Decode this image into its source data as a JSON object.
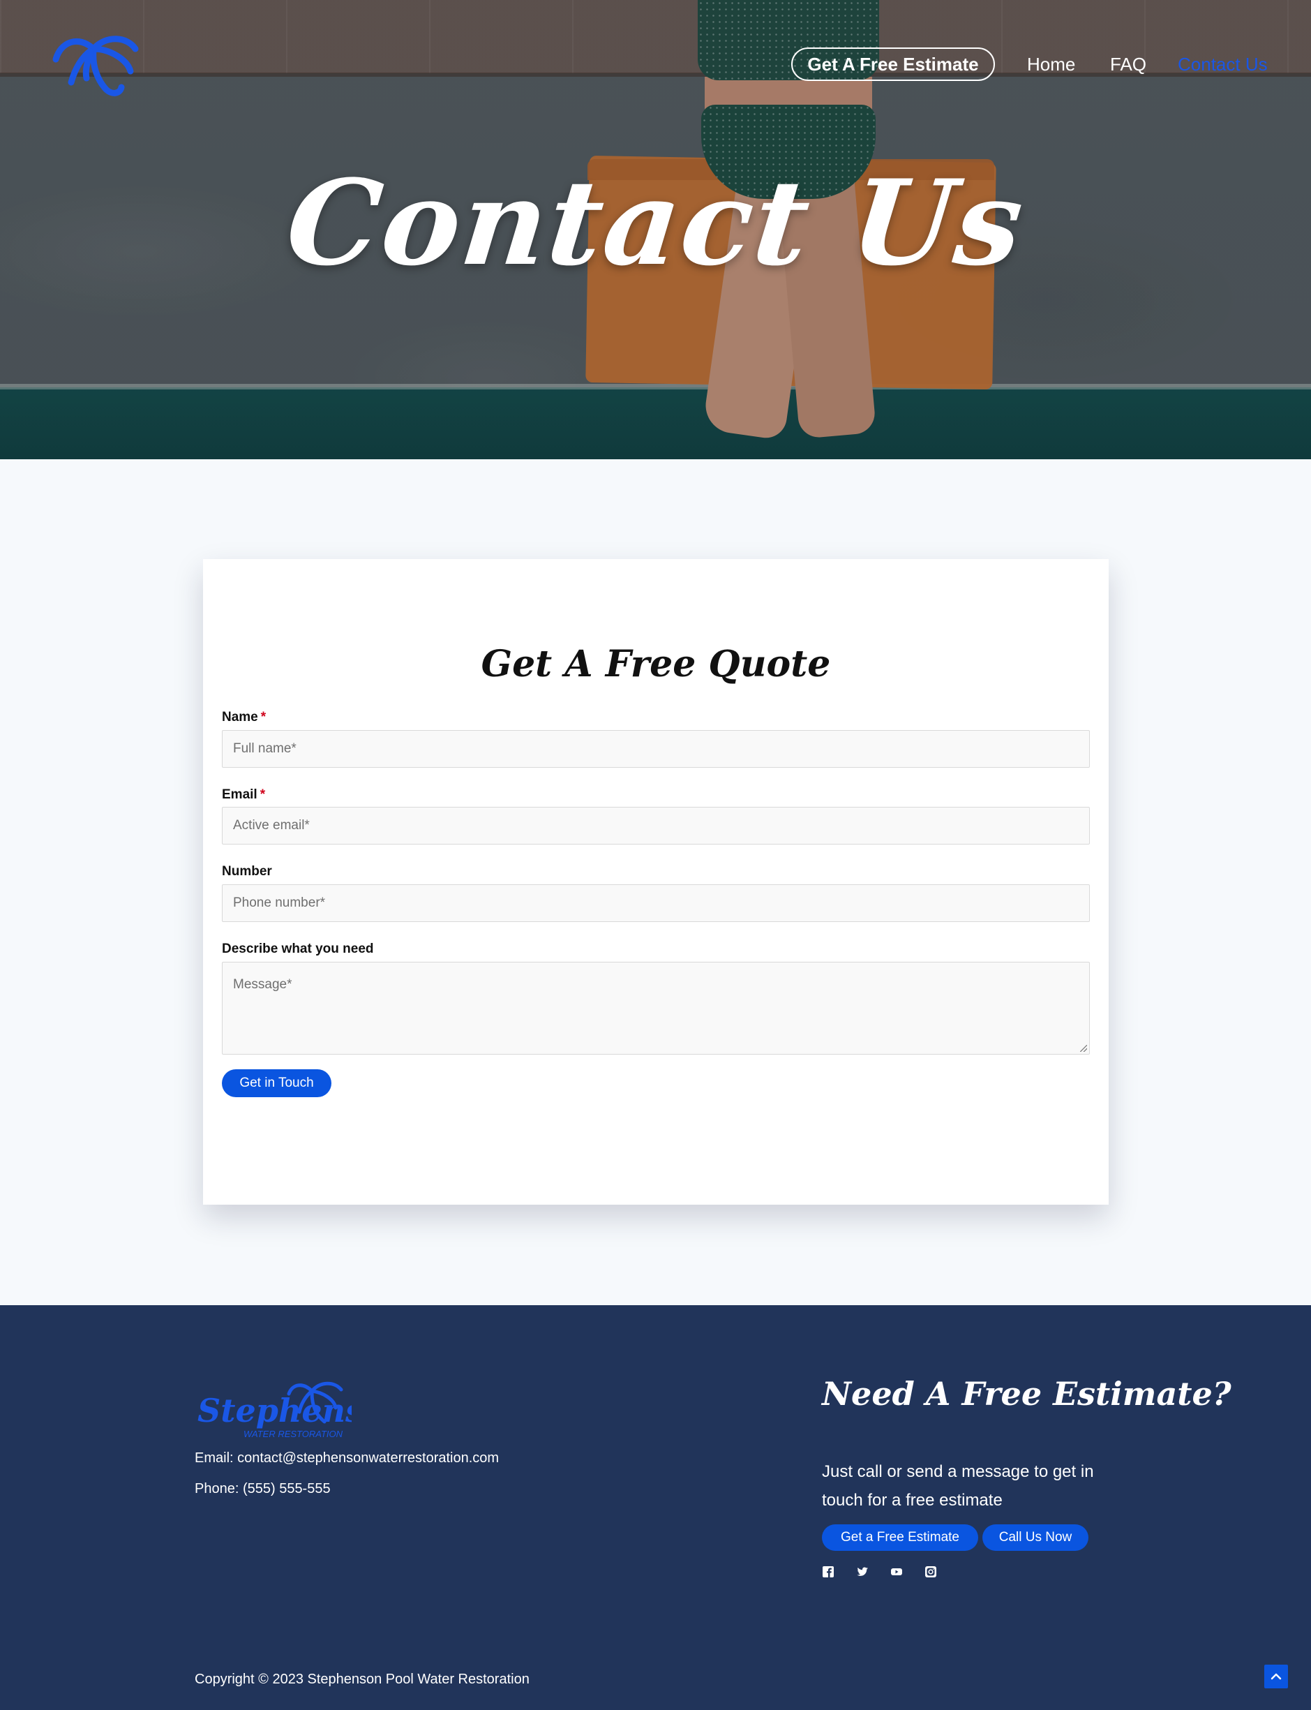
{
  "nav": {
    "cta_label": "Get A Free Estimate",
    "links": [
      "Home",
      "FAQ",
      "Contact Us"
    ],
    "active_color": "#1a57e6"
  },
  "hero": {
    "title": "Contact Us"
  },
  "form": {
    "title": "Get A Free Quote",
    "fields": [
      {
        "label": "Name",
        "required": true,
        "placeholder": "Full name*"
      },
      {
        "label": "Email",
        "required": true,
        "placeholder": "Active email*"
      },
      {
        "label": "Number",
        "required": false,
        "placeholder": "Phone number*"
      },
      {
        "label": "Describe what you need",
        "required": false,
        "placeholder": "Message*"
      }
    ],
    "required_mark": "*",
    "submit_label": "Get in Touch"
  },
  "footer": {
    "logo_text": "Stephenson",
    "logo_subtext": "WATER RESTORATION",
    "email": "Email: contact@stephensonwaterrestoration.com",
    "phone": "Phone: (555) 555-555",
    "heading": "Need A Free Estimate?",
    "text": "Just call or send a message to get in touch for a free estimate",
    "buttons": [
      "Get a Free Estimate",
      "Call Us Now"
    ],
    "social_icons": [
      "facebook-icon",
      "twitter-icon",
      "youtube-icon",
      "instagram-icon"
    ],
    "copyright": "Copyright © 2023 Stephenson Pool Water Restoration"
  },
  "colors": {
    "brand_blue": "#0a55e0",
    "footer_bg": "#21345a",
    "page_bg": "#f6f9fc"
  }
}
